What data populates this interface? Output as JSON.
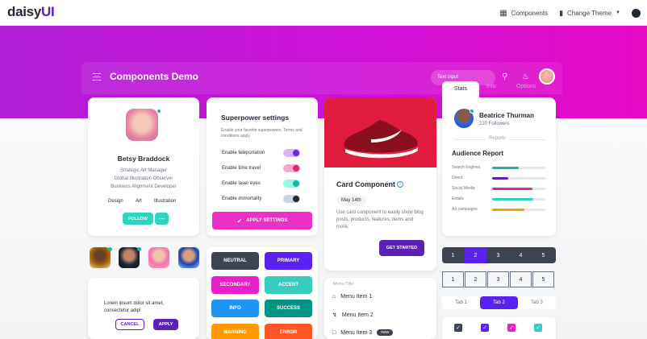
{
  "logo": {
    "prefix": "daisy",
    "suffix": "UI"
  },
  "topnav": {
    "components": "Components",
    "change_theme": "Change Theme"
  },
  "demo": {
    "title": "Components Demo",
    "search_placeholder": "Text Input"
  },
  "profile": {
    "name": "Betsy Braddock",
    "lines": [
      "Strategic Art Manager",
      "Global Illustration Observer",
      "Business Alignment Developer"
    ],
    "tags": [
      "Design",
      "Art",
      "Illustration"
    ],
    "follow": "FOLLOW"
  },
  "superpower": {
    "title": "Superpower settings",
    "desc": "Enable your favorite superpowers. Terms and conditions apply",
    "items": [
      "Enable teleportation",
      "Enable time travel",
      "Enable laser eyes",
      "Enable immortality"
    ],
    "apply": "APPLY SETTINGS"
  },
  "card": {
    "title": "Card Component",
    "date": "May 14th",
    "text": "Use card component to easily show blog posts, products, features, items and more.",
    "cta": "GET STARTED"
  },
  "stats": {
    "tabs": [
      "Stats",
      "Info",
      "Options"
    ],
    "name": "Beatrice Thurman",
    "followers": "220 Followers",
    "divider": "Reports",
    "report_title": "Audience Report",
    "rows": [
      {
        "label": "Search Engines",
        "value": 0.5,
        "color": "#14b8a6"
      },
      {
        "label": "Direct",
        "value": 0.3,
        "color": "#5b21b6"
      },
      {
        "label": "Social Media",
        "value": 0.75,
        "color": "#d926a9"
      },
      {
        "label": "Emails",
        "value": 0.78,
        "color": "#2dd4bf"
      },
      {
        "label": "Ad campaigns",
        "value": 0.6,
        "color": "#f59e0b"
      }
    ]
  },
  "message": {
    "text": "Lorem ipsum dolor sit amet, consectetur adip!",
    "cancel": "CANCEL",
    "apply": "APPLY"
  },
  "colors": {
    "neutral": "NEUTRAL",
    "primary": "PRIMARY",
    "secondary": "SECONDARY",
    "accent": "ACCENT",
    "info": "INFO",
    "success": "SUCCESS",
    "warning": "WARNING",
    "error": "ERROR"
  },
  "menu": {
    "title": "Menu Title",
    "items": [
      "Menu Item 1",
      "Menu Item 2",
      "Menu Item 3"
    ],
    "badge": "new"
  },
  "pagination": {
    "pages": [
      "1",
      "2",
      "3",
      "4",
      "5"
    ],
    "active": "2"
  },
  "tabs2": {
    "items": [
      "Tab 1",
      "Tab 2",
      "Tab 3"
    ],
    "active": "Tab 2"
  }
}
